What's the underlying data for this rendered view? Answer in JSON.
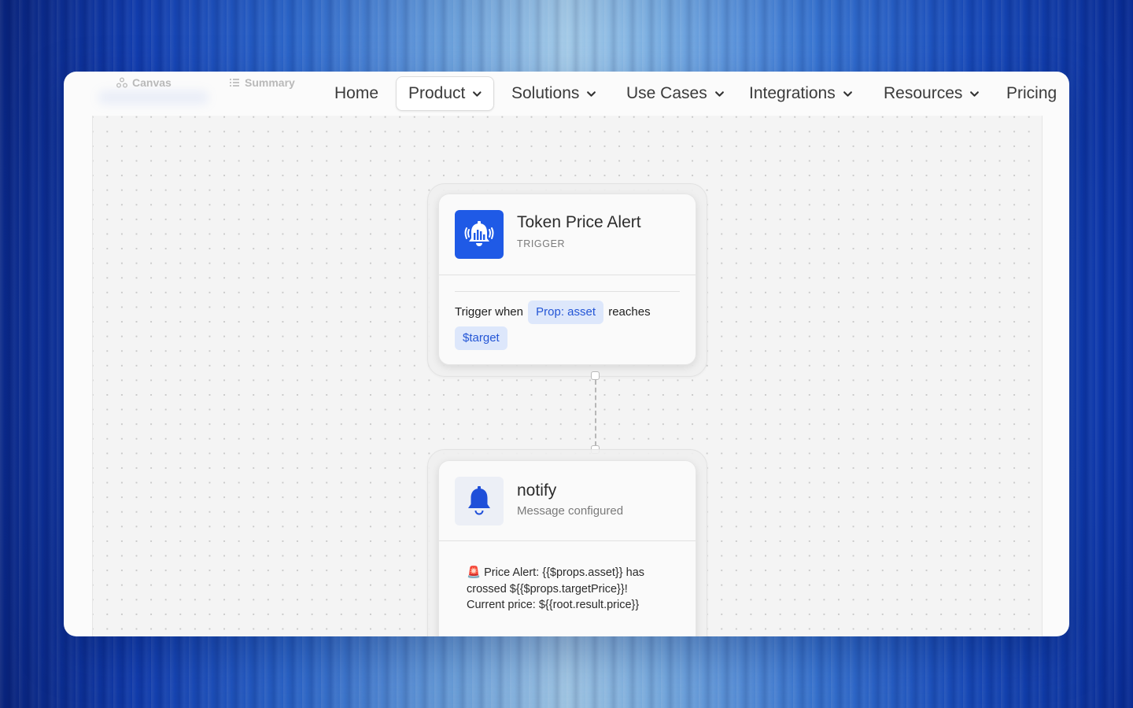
{
  "ghost_tabs": {
    "canvas_label": "Canvas",
    "summary_label": "Summary"
  },
  "nav": {
    "items": [
      {
        "label": "Home",
        "has_dropdown": false,
        "active": false
      },
      {
        "label": "Product",
        "has_dropdown": true,
        "active": true
      },
      {
        "label": "Solutions",
        "has_dropdown": true,
        "active": false
      },
      {
        "label": "Use Cases",
        "has_dropdown": true,
        "active": false
      },
      {
        "label": "Integrations",
        "has_dropdown": true,
        "active": false
      },
      {
        "label": "Resources",
        "has_dropdown": true,
        "active": false
      },
      {
        "label": "Pricing",
        "has_dropdown": false,
        "active": false
      }
    ]
  },
  "trigger_node": {
    "icon": "bell-alert-icon",
    "title": "Token Price Alert",
    "type_label": "TRIGGER",
    "text_before": "Trigger when",
    "chip_asset": "Prop: asset",
    "text_middle": "reaches",
    "chip_target": "$target"
  },
  "notify_node": {
    "icon": "bell-icon",
    "title": "notify",
    "subtitle": "Message configured",
    "message_emoji": "🚨",
    "message_line1": "Price Alert: {{$props.asset}} has",
    "message_line2": "crossed ${{$props.targetPrice}}!",
    "message_line3": "Current price: ${{root.result.price}}"
  },
  "colors": {
    "accent": "#1f5ae6",
    "chip_bg": "#dde7fb",
    "chip_text": "#2456d6"
  }
}
